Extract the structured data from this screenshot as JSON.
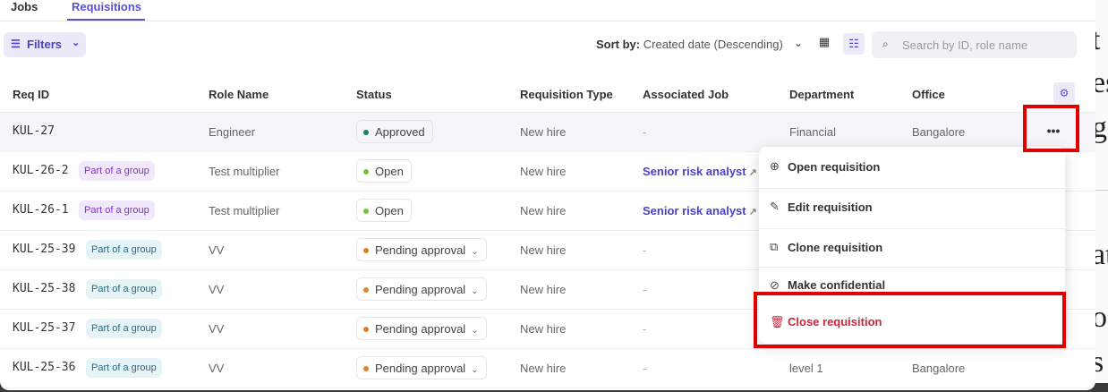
{
  "tabs": [
    "Jobs",
    "Requisitions"
  ],
  "toolbar": {
    "filters_label": "Filters",
    "sort_label": "Sort by:",
    "sort_value": "Created date (Descending)",
    "search_placeholder": "Search by ID, role name"
  },
  "columns": [
    "Req ID",
    "Role Name",
    "Status",
    "Requisition Type",
    "Associated Job",
    "Department",
    "Office"
  ],
  "rows": [
    {
      "id": "KUL-27",
      "group": "",
      "role": "Engineer",
      "status": "Approved",
      "type": "New hire",
      "job": "-",
      "department": "Financial",
      "office": "Bangalore"
    },
    {
      "id": "KUL-26-2",
      "group": "Part of a group",
      "role": "Test multiplier",
      "status": "Open",
      "type": "New hire",
      "job": "Senior risk analyst",
      "department": "",
      "office": ""
    },
    {
      "id": "KUL-26-1",
      "group": "Part of a group",
      "role": "Test multiplier",
      "status": "Open",
      "type": "New hire",
      "job": "Senior risk analyst",
      "department": "",
      "office": ""
    },
    {
      "id": "KUL-25-39",
      "group": "Part of a group",
      "role": "VV",
      "status": "Pending approval",
      "type": "New hire",
      "job": "-",
      "department": "",
      "office": ""
    },
    {
      "id": "KUL-25-38",
      "group": "Part of a group",
      "role": "VV",
      "status": "Pending approval",
      "type": "New hire",
      "job": "-",
      "department": "",
      "office": ""
    },
    {
      "id": "KUL-25-37",
      "group": "Part of a group",
      "role": "VV",
      "status": "Pending approval",
      "type": "New hire",
      "job": "-",
      "department": "",
      "office": ""
    },
    {
      "id": "KUL-25-36",
      "group": "Part of a group",
      "role": "VV",
      "status": "Pending approval",
      "type": "New hire",
      "job": "-",
      "department": "level 1",
      "office": "Bangalore"
    }
  ],
  "menu": {
    "items": [
      "Open requisition",
      "Edit requisition",
      "Clone requisition",
      "Make confidential",
      "Close requisition"
    ]
  },
  "colors": {
    "accent": "#5b4fd6",
    "danger": "#d0253a",
    "highlight_box": "#e00000"
  }
}
